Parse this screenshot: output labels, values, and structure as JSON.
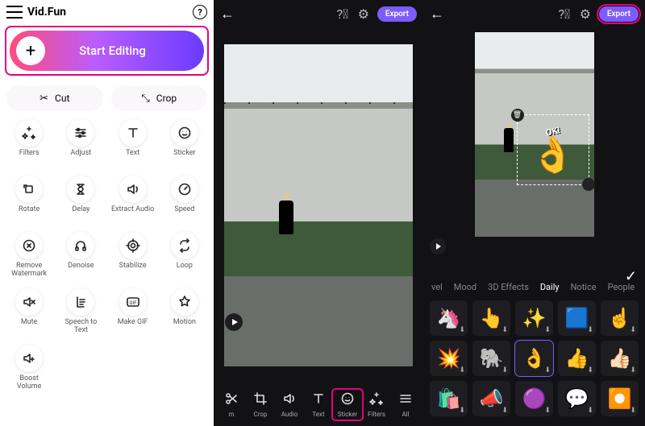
{
  "left": {
    "appTitle": "Vid.Fun",
    "startLabel": "Start Editing",
    "cutLabel": "Cut",
    "cropLabel": "Crop",
    "tools": [
      {
        "id": "filters",
        "label": "Filters",
        "icon": "sparkle"
      },
      {
        "id": "adjust",
        "label": "Adjust",
        "icon": "sliders"
      },
      {
        "id": "text",
        "label": "Text",
        "icon": "text"
      },
      {
        "id": "sticker",
        "label": "Sticker",
        "icon": "smile"
      },
      {
        "id": "rotate",
        "label": "Rotate",
        "icon": "rotate"
      },
      {
        "id": "delay",
        "label": "Delay",
        "icon": "hourglass"
      },
      {
        "id": "extract-audio",
        "label": "Extract Audio",
        "icon": "audio"
      },
      {
        "id": "speed",
        "label": "Speed",
        "icon": "gauge"
      },
      {
        "id": "remove-watermark",
        "label": "Remove Watermark",
        "icon": "badge-x"
      },
      {
        "id": "denoise",
        "label": "Denoise",
        "icon": "headphones"
      },
      {
        "id": "stabilize",
        "label": "Stabilize",
        "icon": "target"
      },
      {
        "id": "loop",
        "label": "Loop",
        "icon": "loop"
      },
      {
        "id": "mute",
        "label": "Mute",
        "icon": "mute"
      },
      {
        "id": "speech-to-text",
        "label": "Speech to Text",
        "icon": "stt"
      },
      {
        "id": "make-gif",
        "label": "Make GIF",
        "icon": "gif"
      },
      {
        "id": "motion",
        "label": "Motion",
        "icon": "star"
      },
      {
        "id": "boost-volume",
        "label": "Boost Volume",
        "icon": "volplus"
      }
    ]
  },
  "mid": {
    "exportLabel": "Export",
    "tools": [
      {
        "id": "trim",
        "label": "m",
        "icon": "scissors"
      },
      {
        "id": "crop",
        "label": "Crop",
        "icon": "crop"
      },
      {
        "id": "audio",
        "label": "Audio",
        "icon": "audio"
      },
      {
        "id": "text",
        "label": "Text",
        "icon": "text"
      },
      {
        "id": "sticker",
        "label": "Sticker",
        "icon": "smile",
        "highlight": true
      },
      {
        "id": "filters",
        "label": "Filters",
        "icon": "sparkle"
      },
      {
        "id": "all",
        "label": "All",
        "icon": "menu"
      }
    ]
  },
  "right": {
    "exportLabel": "Export",
    "stickerText": "OK!",
    "tabs": [
      "vel",
      "Mood",
      "3D Effects",
      "Daily",
      "Notice",
      "People"
    ],
    "activeTab": 3,
    "stickers": [
      {
        "glyph": "🦄"
      },
      {
        "glyph": "👆"
      },
      {
        "glyph": "✨"
      },
      {
        "glyph": "🟦"
      },
      {
        "glyph": "☝️"
      },
      {
        "glyph": "💥"
      },
      {
        "glyph": "🐘"
      },
      {
        "glyph": "👌",
        "selected": true
      },
      {
        "glyph": "👍"
      },
      {
        "glyph": "👍🏻"
      },
      {
        "glyph": "🛍️"
      },
      {
        "glyph": "📣"
      },
      {
        "glyph": "🟣"
      },
      {
        "glyph": "💬"
      },
      {
        "glyph": "⏺️"
      }
    ]
  }
}
